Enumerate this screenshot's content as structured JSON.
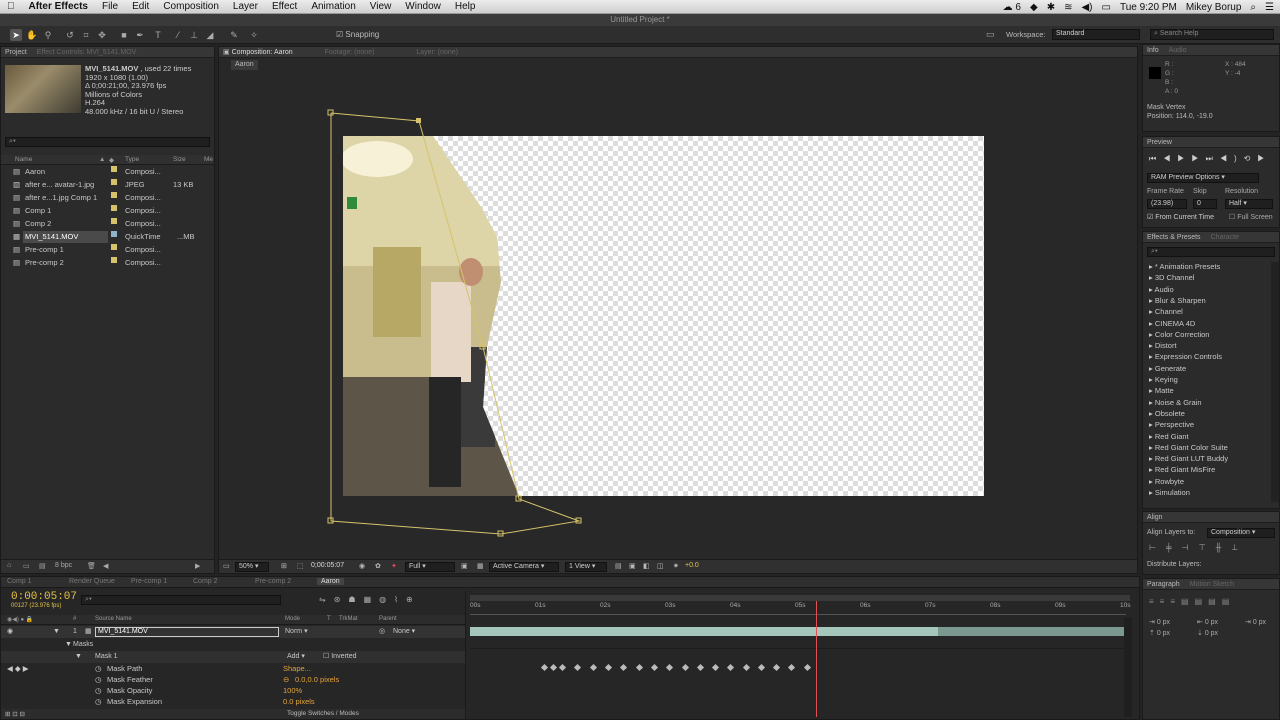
{
  "menubar": {
    "apple": "",
    "app": "After Effects",
    "items": [
      "File",
      "Edit",
      "Composition",
      "Layer",
      "Effect",
      "Animation",
      "View",
      "Window",
      "Help"
    ],
    "status": {
      "cloud": "6",
      "time": "Tue 9:20 PM",
      "user": "Mikey Borup"
    }
  },
  "window_title": "Untitled Project *",
  "toolbar": {
    "snapping": "Snapping",
    "workspace_label": "Workspace:",
    "workspace_value": "Standard",
    "search_placeholder": "Search Help"
  },
  "project": {
    "tab": "Project",
    "tab_effect_controls": "Effect Controls: MVI_5141.MOV",
    "file_name": "MVI_5141.MOV",
    "file_used": ", used 22 times",
    "info": [
      "1920 x 1080 (1.00)",
      "Δ 0;00:21;00, 23.976 fps",
      "Millions of Colors",
      "H.264",
      "48.000 kHz / 16 bit U / Stereo"
    ],
    "columns": {
      "name": "Name",
      "type": "Type",
      "size": "Size",
      "media": "Me"
    },
    "items": [
      {
        "name": "Aaron",
        "type": "Composi...",
        "size": ""
      },
      {
        "name": "after e... avatar-1.jpg",
        "type": "JPEG",
        "size": "13 KB"
      },
      {
        "name": "after e...1.jpg Comp 1",
        "type": "Composi...",
        "size": ""
      },
      {
        "name": "Comp 1",
        "type": "Composi...",
        "size": ""
      },
      {
        "name": "Comp 2",
        "type": "Composi...",
        "size": ""
      },
      {
        "name": "MVI_5141.MOV",
        "type": "QuickTime",
        "size": "...MB"
      },
      {
        "name": "Pre-comp 1",
        "type": "Composi...",
        "size": ""
      },
      {
        "name": "Pre-comp 2",
        "type": "Composi...",
        "size": ""
      }
    ],
    "bpc": "8 bpc"
  },
  "comp_viewer": {
    "tab": "Composition: Aaron",
    "footage": "Footage: (none)",
    "layer": "Layer: (none)",
    "breadcrumb": "Aaron",
    "zoom": "50%",
    "timecode": "0;00:05:07",
    "resolution": "Full",
    "camera": "Active Camera",
    "view": "1 View",
    "exposure": "+0.0"
  },
  "info_panel": {
    "tab": "Info",
    "tab2": "Audio",
    "r": "R :",
    "g": "G :",
    "b": "B :",
    "a": "A : 0",
    "x": "X : 484",
    "y": "Y : -4",
    "vertex_title": "Mask Vertex",
    "vertex_pos": "Position: 114.0, -19.0"
  },
  "preview_panel": {
    "tab": "Preview",
    "ram": "RAM Preview Options",
    "frame_rate_label": "Frame Rate",
    "skip_label": "Skip",
    "resolution_label": "Resolution",
    "frame_rate": "(23.98)",
    "skip": "0",
    "resolution": "Half",
    "from_current": "From Current Time",
    "full_screen": "Full Screen"
  },
  "effects_panel": {
    "tab": "Effects & Presets",
    "tab2": "Characte",
    "items": [
      "* Animation Presets",
      "3D Channel",
      "Audio",
      "Blur & Sharpen",
      "Channel",
      "CINEMA 4D",
      "Color Correction",
      "Distort",
      "Expression Controls",
      "Generate",
      "Keying",
      "Matte",
      "Noise & Grain",
      "Obsolete",
      "Perspective",
      "Red Giant",
      "Red Giant Color Suite",
      "Red Giant LUT Buddy",
      "Red Giant MisFire",
      "Rowbyte",
      "Simulation"
    ]
  },
  "align_panel": {
    "tab": "Align",
    "align_to_label": "Align Layers to:",
    "align_to_value": "Composition",
    "distribute": "Distribute Layers:"
  },
  "paragraph_panel": {
    "tab": "Paragraph",
    "tab2": "Motion Sketch",
    "values": [
      "0 px",
      "0 px",
      "0 px",
      "0 px",
      "0 px"
    ]
  },
  "timeline": {
    "tabs": [
      "Comp 1",
      "Render Queue",
      "Pre-comp 1",
      "Comp 2",
      "Pre-comp 2",
      "Aaron"
    ],
    "timecode": "0:00:05:07",
    "fps": "00127 (23.976 fps)",
    "columns": {
      "num": "#",
      "source": "Source Name",
      "mode": "Mode",
      "t": "T",
      "trkmat": "TrkMat",
      "parent": "Parent"
    },
    "layer": {
      "num": "1",
      "name": "MVI_5141.MOV",
      "mode": "Norm",
      "parent": "None"
    },
    "masks_label": "Masks",
    "mask1": "Mask 1",
    "mask_mode": "Add",
    "inverted": "Inverted",
    "props": [
      {
        "name": "Mask Path",
        "value": "Shape..."
      },
      {
        "name": "Mask Feather",
        "value": "0.0,0.0 pixels"
      },
      {
        "name": "Mask Opacity",
        "value": "100%"
      },
      {
        "name": "Mask Expansion",
        "value": "0.0 pixels"
      }
    ],
    "ruler": [
      "00s",
      "01s",
      "02s",
      "03s",
      "04s",
      "05s",
      "06s",
      "07s",
      "08s",
      "09s",
      "10s"
    ],
    "toggle": "Toggle Switches / Modes",
    "playhead_fraction": 0.527,
    "keyframes": [
      0.11,
      0.123,
      0.137,
      0.16,
      0.184,
      0.207,
      0.23,
      0.254,
      0.277,
      0.3,
      0.324,
      0.347,
      0.37,
      0.394,
      0.417,
      0.44,
      0.464,
      0.487,
      0.51
    ]
  },
  "colors": {
    "accent": "#e8a33c",
    "mask": "#d4c36b",
    "timecode": "#e3c24a",
    "layer_bar": "#a4c6bb"
  }
}
